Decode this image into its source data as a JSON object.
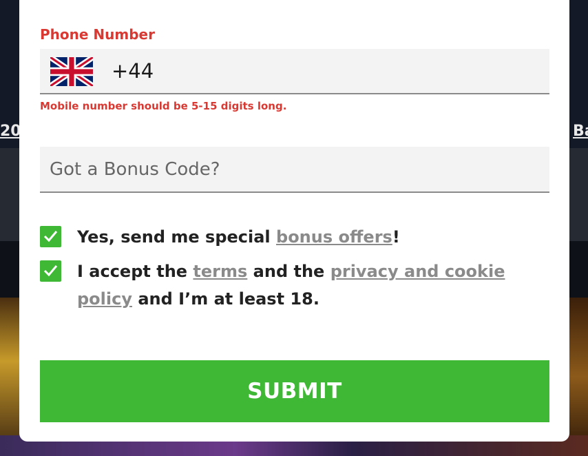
{
  "background": {
    "edge_left_text": "20",
    "edge_right_text": "Ba"
  },
  "form": {
    "phone_label": "Phone Number",
    "country_flag": "uk-flag-icon",
    "dial_code": "+44",
    "phone_error": "Mobile number should be 5-15 digits long.",
    "bonus_placeholder": "Got a Bonus Code?",
    "bonus_value": "",
    "offers_checkbox": {
      "checked": true,
      "prefix": "Yes, send me special ",
      "link": "bonus offers",
      "suffix": "!"
    },
    "terms_checkbox": {
      "checked": true,
      "prefix": "I accept the ",
      "terms_link": "terms",
      "middle": " and the ",
      "privacy_link": "privacy and cookie policy",
      "suffix": " and I’m at least 18."
    },
    "submit_label": "SUBMIT"
  },
  "colors": {
    "accent_green": "#3fb935",
    "error_red": "#d83a33",
    "link_gray": "#8a8a8a"
  }
}
